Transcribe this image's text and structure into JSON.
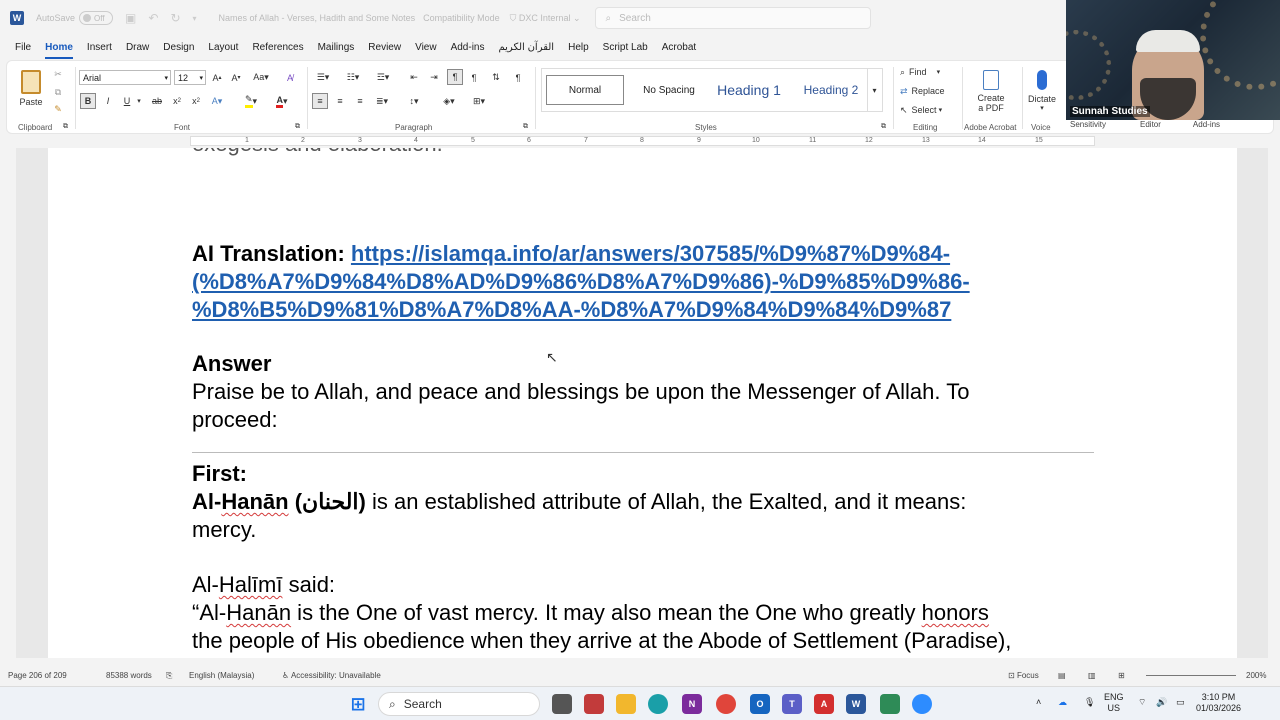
{
  "titlebar": {
    "autosave_label": "AutoSave",
    "autosave_state": "Off",
    "doc_title": "Names of Allah - Verses, Hadith and Some Notes",
    "mode": "Compatibility Mode",
    "sensitivity": "DXC Internal",
    "search_placeholder": "Search"
  },
  "tabs": [
    "File",
    "Home",
    "Insert",
    "Draw",
    "Design",
    "Layout",
    "References",
    "Mailings",
    "Review",
    "View",
    "Add-ins",
    "القرآن الكريم",
    "Help",
    "Script Lab",
    "Acrobat"
  ],
  "active_tab": "Home",
  "ribbon": {
    "clipboard": {
      "paste": "Paste",
      "label": "Clipboard"
    },
    "font": {
      "name": "Arial",
      "size": "12",
      "label": "Font"
    },
    "paragraph": {
      "label": "Paragraph"
    },
    "styles": {
      "items": [
        "Normal",
        "No Spacing",
        "Heading 1",
        "Heading 2"
      ],
      "selected": "Normal",
      "label": "Styles"
    },
    "editing": {
      "find": "Find",
      "replace": "Replace",
      "select": "Select",
      "label": "Editing"
    },
    "acrobat": {
      "create": "Create",
      "create2": "a PDF",
      "label": "Adobe Acrobat"
    },
    "voice": {
      "dictate": "Dictate",
      "label": "Voice"
    },
    "extra_labels": [
      "Sensitivity",
      "Editor",
      "Add-ins"
    ]
  },
  "webcam": {
    "name": "Sunnah Studies"
  },
  "ruler": {
    "numbers": [
      "1",
      "2",
      "3",
      "4",
      "5",
      "6",
      "7",
      "8",
      "9",
      "10",
      "11",
      "12",
      "13",
      "14",
      "15"
    ]
  },
  "document": {
    "partial_top": "exegesis and elaboration.",
    "ai_label": "AI Translation:",
    "link_lines": [
      "https://islamqa.info/ar/answers/307585/%D9%87%D9%84-",
      "(%D8%A7%D9%84%D8%AD%D9%86%D8%A7%D9%86)-%D9%85%D9%86-",
      "%D8%B5%D9%81%D8%A7%D8%AA-%D8%A7%D9%84%D9%84%D9%87"
    ],
    "answer_heading": "Answer",
    "praise_line1": "Praise be to Allah, and peace and blessings be upon the Messenger of Allah. To",
    "praise_line2": "proceed:",
    "first_heading": "First:",
    "hanan_prefix": "Al-",
    "hanan_word": "Hanān",
    "hanan_arabic": "(الحنان)",
    "hanan_rest": " is an established attribute of Allah, the Exalted, and it means:",
    "hanan_line2": "mercy.",
    "halimi_prefix": "Al-",
    "halimi_word": "Halīmī",
    "halimi_rest": " said:",
    "quote_start": "“Al-",
    "quote_word": "Hanān",
    "quote_mid": " is the One of vast mercy. It may also mean the One who greatly ",
    "quote_honors": "honors",
    "quote_line2": "the people of His obedience when they arrive at the Abode of Settlement (Paradise),"
  },
  "status": {
    "page": "Page 206 of 209",
    "words": "85388 words",
    "language": "English (Malaysia)",
    "accessibility": "Accessibility: Unavailable",
    "focus": "Focus",
    "zoom": "200%"
  },
  "taskbar": {
    "search": "Search",
    "lang": "ENG",
    "region": "US",
    "time": "3:10 PM",
    "date": "01/03/2026"
  },
  "colors": {
    "accent": "#185abd",
    "link": "#1f5fb0",
    "word": "#2b579a"
  }
}
